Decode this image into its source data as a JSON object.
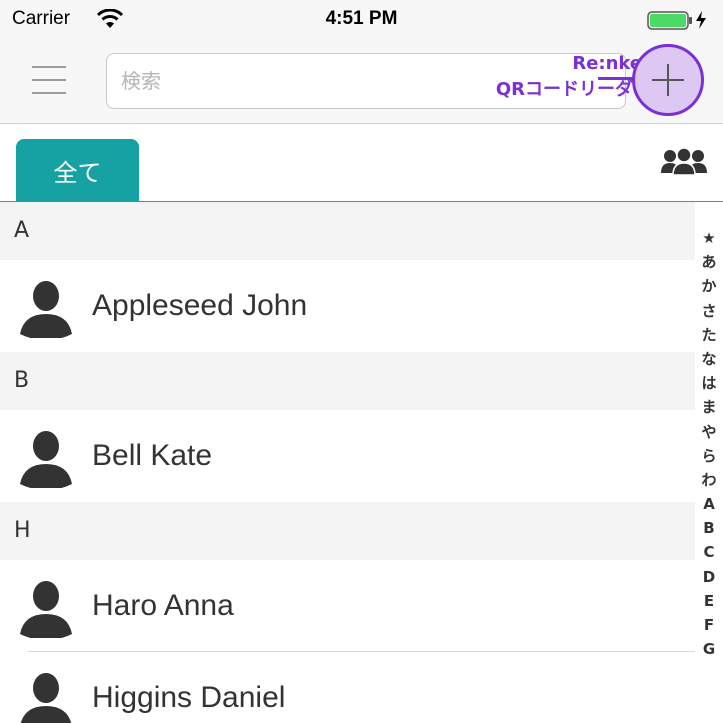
{
  "status_bar": {
    "carrier": "Carrier",
    "time": "4:51 PM"
  },
  "nav": {
    "search_placeholder": "検索",
    "annotation_line1": "Re:nker追加",
    "annotation_line2": "QRコードリーダー起動",
    "annotation_color": "#7b2fd6"
  },
  "tabs": {
    "all_label": "全て",
    "accent_color": "#16a2a2"
  },
  "contacts": {
    "section_a": "A",
    "section_b": "B",
    "section_h": "H",
    "appleseed": "Appleseed John",
    "bell": "Bell Kate",
    "haro": "Haro Anna",
    "higgins": "Higgins Daniel"
  },
  "index": [
    "★",
    "あ",
    "か",
    "さ",
    "た",
    "な",
    "は",
    "ま",
    "や",
    "ら",
    "わ",
    "A",
    "B",
    "C",
    "D",
    "E",
    "F",
    "G"
  ]
}
